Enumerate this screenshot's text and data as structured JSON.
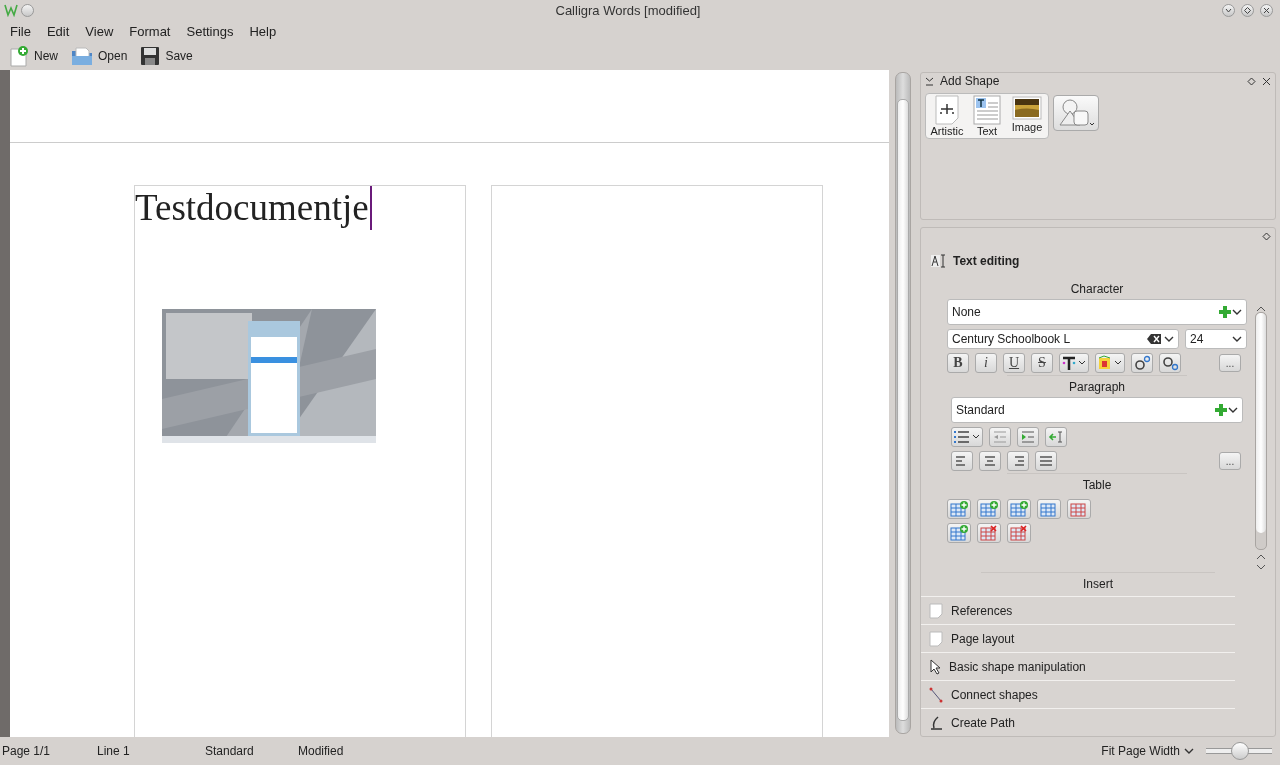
{
  "window": {
    "title": "Calligra Words [modified]"
  },
  "menu": [
    "File",
    "Edit",
    "View",
    "Format",
    "Settings",
    "Help"
  ],
  "toolbar": [
    {
      "label": "New",
      "kind": "new"
    },
    {
      "label": "Open",
      "kind": "open"
    },
    {
      "label": "Save",
      "kind": "save"
    }
  ],
  "document": {
    "heading": "Testdocumentje"
  },
  "add_shape": {
    "title": "Add Shape",
    "shapes": [
      {
        "label": "Artistic",
        "kind": "artistic"
      },
      {
        "label": "Text",
        "kind": "text"
      },
      {
        "label": "Image"
      }
    ]
  },
  "text_editing": {
    "title": "Text editing",
    "character": {
      "heading": "Character",
      "style": "None",
      "font": "Century Schoolbook L",
      "size": "24",
      "buttons": [
        {
          "glyph": "B",
          "kind": "bold"
        },
        {
          "glyph": "i",
          "kind": "italic"
        },
        {
          "glyph": "U",
          "kind": "underline"
        },
        {
          "glyph": "S",
          "kind": "strike"
        }
      ],
      "more": "..."
    },
    "paragraph": {
      "heading": "Paragraph",
      "style": "Standard",
      "more": "..."
    },
    "table": {
      "heading": "Table"
    },
    "insert": {
      "heading": "Insert"
    }
  },
  "tools": [
    {
      "label": "References",
      "kind": "page"
    },
    {
      "label": "Page layout",
      "kind": "page"
    },
    {
      "label": "Basic shape manipulation",
      "kind": "pointer"
    },
    {
      "label": "Connect shapes",
      "kind": "connector"
    },
    {
      "label": "Create Path",
      "kind": "path"
    }
  ],
  "status_bar": {
    "page": "Page 1/1",
    "line": "Line 1",
    "style": "Standard",
    "state": "Modified",
    "zoom": "Fit Page Width",
    "zoom_slider": {
      "level": 0.5
    }
  }
}
